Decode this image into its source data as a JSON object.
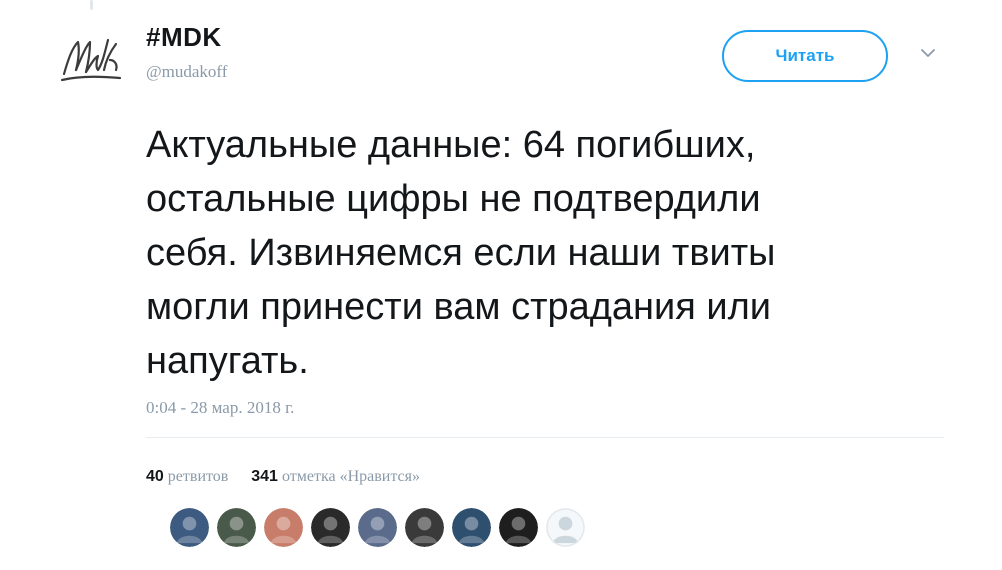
{
  "tweet": {
    "author": {
      "display_name": "#MDK",
      "handle": "@mudakoff",
      "avatar_icon": "mdk-logo-icon"
    },
    "follow_label": "Читать",
    "text": "Актуальные данные: 64 погибших,\nостальные цифры не подтвердили\nсебя. Извиняемся если наши твиты\nмогли принести вам страдания или\nнапугать.",
    "timestamp": "0:04 - 28 мар. 2018 г.",
    "stats": {
      "retweets_count": "40",
      "retweets_label": "ретвитов",
      "likes_count": "341",
      "likes_label": "отметка «Нравится»"
    },
    "likers": [
      {
        "icon": "user-avatar-icon",
        "color": "#3d5a80"
      },
      {
        "icon": "user-avatar-icon",
        "color": "#4a5a4a"
      },
      {
        "icon": "user-avatar-icon",
        "color": "#c87d6a"
      },
      {
        "icon": "user-avatar-icon",
        "color": "#2a2a2a"
      },
      {
        "icon": "user-avatar-icon",
        "color": "#5b6b8c"
      },
      {
        "icon": "user-avatar-icon",
        "color": "#3a3a3a"
      },
      {
        "icon": "user-avatar-icon",
        "color": "#2f4f6f"
      },
      {
        "icon": "user-avatar-icon",
        "color": "#1e1e1e"
      },
      {
        "icon": "default-avatar-icon",
        "color": "#ccd6dd"
      }
    ]
  },
  "colors": {
    "accent": "#1da1f2",
    "text": "#14171a",
    "muted": "#8a9aa8",
    "divider": "#e6ecf0"
  }
}
